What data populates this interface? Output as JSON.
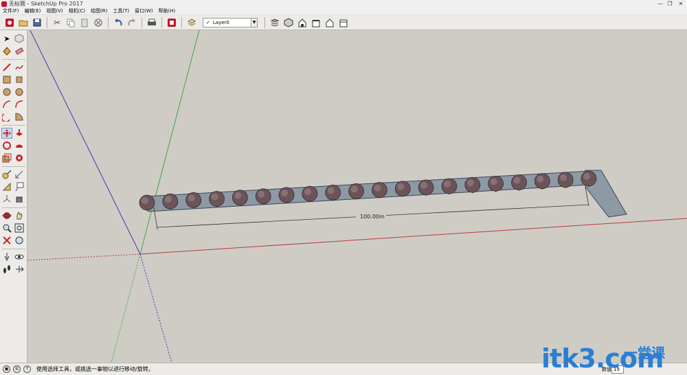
{
  "window": {
    "title": "无标题 - SketchUp Pro 2017",
    "minimize": "—",
    "maximize": "❐",
    "close": "✕"
  },
  "menu": [
    "文件(F)",
    "编辑(E)",
    "视图(V)",
    "相机(C)",
    "绘图(R)",
    "工具(T)",
    "窗口(W)",
    "帮助(H)"
  ],
  "toolbar": {
    "layer": {
      "check": "✓",
      "name": "Layer0",
      "arrow": "▼"
    },
    "icons": [
      "get-started-icon",
      "open-icon",
      "save-icon",
      "cut-icon",
      "copy-icon",
      "paste-icon",
      "erase-icon",
      "undo-icon",
      "redo-icon",
      "print-icon",
      "model-info-icon",
      "layer-manager-icon",
      "iso-view-icon",
      "top-view-icon",
      "front-view-icon",
      "right-view-icon",
      "back-view-icon",
      "left-view-icon"
    ]
  },
  "viewport": {
    "dimension_label": "100.00m",
    "tree_count": 20
  },
  "status": {
    "message": "使用选择工具，或挑选一事物以进行移动/旋转。",
    "measure_label": "数值",
    "measure_value": "19"
  },
  "watermark": {
    "main": "itk3",
    "dotcom": ".com",
    "sub": "一堂课"
  },
  "colors": {
    "axis_red": "#b83c3c",
    "axis_green": "#3ea83e",
    "axis_blue": "#3b3bb4",
    "surface": "#8d9aa6",
    "tree_fill": "#6b5357",
    "watermark": "#2b7fd3"
  }
}
